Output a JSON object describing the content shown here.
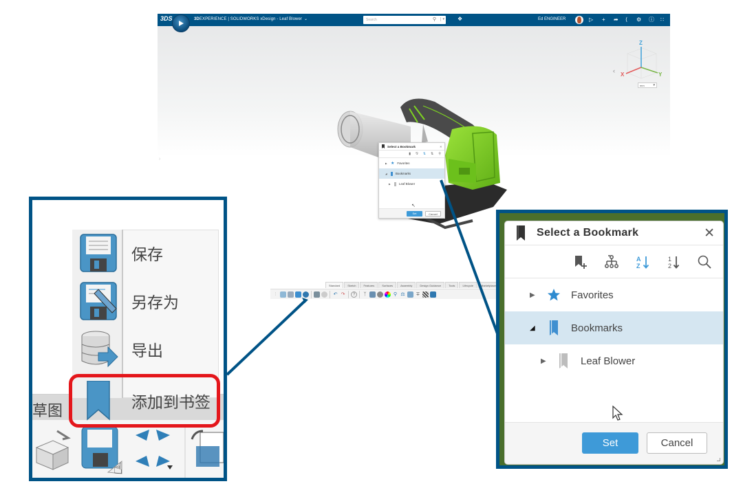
{
  "app": {
    "brand": "3D",
    "product": "EXPERIENCE | SOLIDWORKS",
    "document": "xDesign - Leaf Blower",
    "search_placeholder": "Search",
    "user_name": "Ed ENGINEER"
  },
  "topbar_icons": [
    "tag-icon",
    "notifications-icon",
    "add-icon",
    "share-icon",
    "connect-icon",
    "tools-icon",
    "help-icon",
    "apps-grid-icon"
  ],
  "viewport": {
    "triad_labels": {
      "x": "X",
      "y": "Y",
      "z": "Z"
    },
    "units": "mm"
  },
  "mini_dialog": {
    "title": "Select a Bookmark",
    "items": [
      {
        "label": "Favorites"
      },
      {
        "label": "Bookmarks",
        "selected": true
      },
      {
        "label": "Leaf Blower"
      }
    ],
    "set_label": "Set",
    "cancel_label": "Cancel"
  },
  "ribbon": {
    "tabs": [
      {
        "label": "Standard",
        "active": true
      },
      {
        "label": "Sketch"
      },
      {
        "label": "Features"
      },
      {
        "label": "Surfaces"
      },
      {
        "label": "Assembly"
      },
      {
        "label": "Design Guidance"
      },
      {
        "label": "Tools"
      },
      {
        "label": "Lifecycle"
      },
      {
        "label": "Marketplace"
      }
    ]
  },
  "save_menu": {
    "items": [
      {
        "label": "保存",
        "icon": "save-icon"
      },
      {
        "label": "另存为",
        "icon": "save-as-icon"
      },
      {
        "label": "导出",
        "icon": "export-icon"
      },
      {
        "label": "添加到书签",
        "icon": "bookmark-icon",
        "highlighted": true
      }
    ],
    "background_tab": "草图",
    "highlight_color": "#e4161b"
  },
  "bookmark_dialog": {
    "title": "Select a Bookmark",
    "toolbar": [
      {
        "name": "add-bookmark",
        "icon": "add-bookmark-icon"
      },
      {
        "name": "tree-structure",
        "icon": "hierarchy-icon"
      },
      {
        "name": "sort-alpha",
        "icon": "sort-az-icon",
        "active": true
      },
      {
        "name": "sort-numeric",
        "icon": "sort-12-icon"
      },
      {
        "name": "search",
        "icon": "search-icon"
      }
    ],
    "tree": [
      {
        "label": "Favorites",
        "expanded": false,
        "icon": "star-icon"
      },
      {
        "label": "Bookmarks",
        "expanded": true,
        "selected": true,
        "icon": "bookmark-icon"
      },
      {
        "label": "Leaf Blower",
        "expanded": false,
        "icon": "bookmark-gray-icon",
        "level": 1
      }
    ],
    "set_label": "Set",
    "cancel_label": "Cancel"
  },
  "colors": {
    "brand_blue": "#005386",
    "accent_blue": "#3e9ad8",
    "selection_bg": "#d5e6f1",
    "model_green": "#7ed321"
  }
}
